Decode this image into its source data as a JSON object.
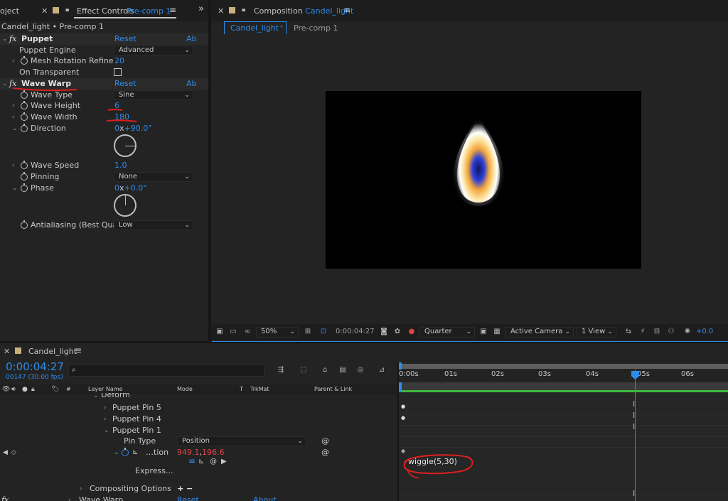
{
  "effect_controls": {
    "tabs": {
      "project_fragment": "oject",
      "effect_controls_label": "Effect Controls",
      "effect_controls_target": "Pre-comp 1"
    },
    "breadcrumb": "Candel_light • Pre-comp 1",
    "puppet": {
      "fx": "fx",
      "name": "Puppet",
      "reset": "Reset",
      "about": "Ab",
      "engine_label": "Puppet Engine",
      "engine_value": "Advanced",
      "mesh_label": "Mesh Rotation Refine",
      "mesh_value": "20",
      "on_transparent_label": "On Transparent"
    },
    "wave_warp": {
      "fx": "fx",
      "name": "Wave Warp",
      "reset": "Reset",
      "about": "Ab",
      "wave_type_label": "Wave Type",
      "wave_type_value": "Sine",
      "wave_height_label": "Wave Height",
      "wave_height_value": "6",
      "wave_width_label": "Wave Width",
      "wave_width_value": "180",
      "direction_label": "Direction",
      "direction_rev": "0",
      "direction_x": "x",
      "direction_deg": "+90.0",
      "deg": "°",
      "wave_speed_label": "Wave Speed",
      "wave_speed_value": "1.0",
      "pinning_label": "Pinning",
      "pinning_value": "None",
      "phase_label": "Phase",
      "phase_rev": "0",
      "phase_x": "x",
      "phase_deg": "+0.0",
      "antialias_label": "Antialiasing (Best Qua",
      "antialias_value": "Low"
    }
  },
  "composition": {
    "tab_prefix": "Composition",
    "tab_name": "Candel_light",
    "sub_tabs": [
      "Candel_light",
      "Pre-comp 1"
    ],
    "footer": {
      "zoom": "50%",
      "timecode": "0:00:04:27",
      "resolution": "Quarter",
      "camera": "Active Camera",
      "view": "1 View",
      "exposure": "+0.0"
    }
  },
  "timeline": {
    "tab_name": "Candel_light",
    "timecode": "0:00:04:27",
    "frame_info": "00147 (30.00 fps)",
    "search_placeholder": "",
    "columns": {
      "layer_name": "Layer Name",
      "mode": "Mode",
      "t": "T",
      "trkmat": "TrkMat",
      "parent": "Parent & Link",
      "hash": "#"
    },
    "ruler": [
      "0:00s",
      "01s",
      "02s",
      "03s",
      "04s",
      "05s",
      "06s"
    ],
    "layers": {
      "deform": "Deform",
      "pin5": "Puppet Pin 5",
      "pin4": "Puppet Pin 4",
      "pin1": "Puppet Pin 1",
      "pin_type_label": "Pin Type",
      "pin_type_value": "Position",
      "position_label": "…tion",
      "position_x": "949.1",
      "position_sep": ",",
      "position_y": "196.6",
      "expression_label": "Express...",
      "compositing": "Compositing Options",
      "compositing_ops": "+ −",
      "wave_warp_label": "Wave Warp",
      "wave_warp_reset": "Reset",
      "wave_warp_about": "About"
    },
    "expression_text": "wiggle(5,30)"
  },
  "colors": {
    "accent_blue": "#2d8ceb",
    "annotation_red": "#e01e1e",
    "keyframe_value_red": "#e34545",
    "work_area_green": "#3dba3d"
  }
}
